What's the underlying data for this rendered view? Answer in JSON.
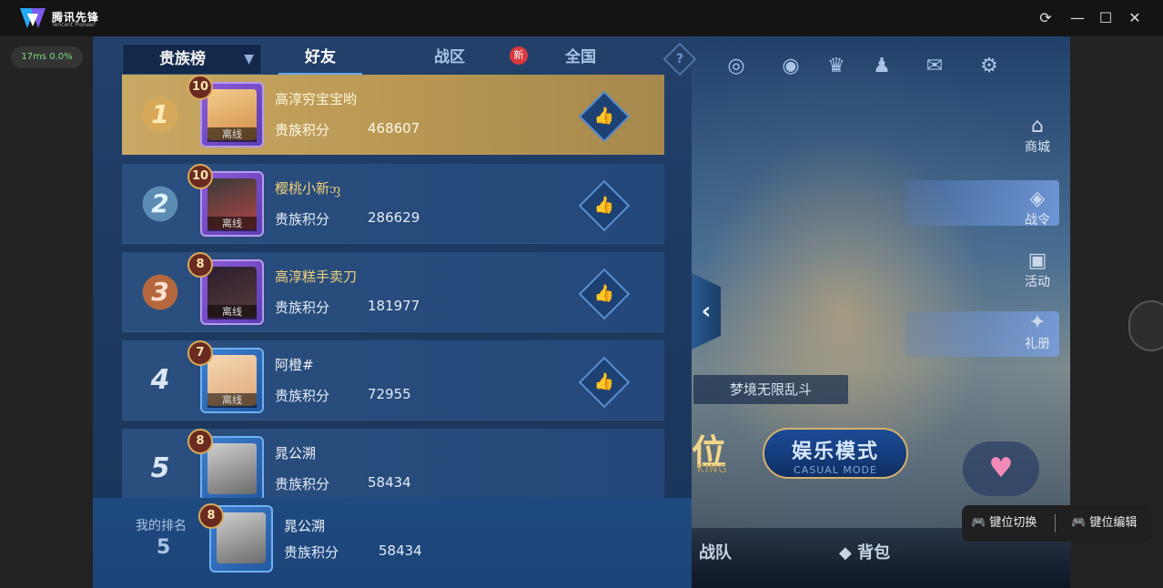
{
  "titlebar": {
    "app_name": "腾讯先锋",
    "app_sub": "Tencent Pioneer",
    "refresh_icon": "⟳",
    "minimize_icon": "—",
    "maximize_icon": "☐",
    "close_icon": "✕"
  },
  "perf": {
    "latency": "17ms",
    "loss": "0.0%"
  },
  "leaderboard": {
    "dropdown_label": "贵族榜",
    "tabs": [
      {
        "label": "好友",
        "active": true
      },
      {
        "label": "战区",
        "active": false
      },
      {
        "label": "全国",
        "active": false
      }
    ],
    "new_badge": "新",
    "help": "?",
    "score_label": "贵族积分",
    "offline_label": "离线",
    "rows": [
      {
        "rank": "1",
        "level": "10",
        "name": "高淳穷宝宝哟",
        "score": "468607",
        "offline": true
      },
      {
        "rank": "2",
        "level": "10",
        "name": "樱桃小新ᦀ",
        "score": "286629",
        "offline": true
      },
      {
        "rank": "3",
        "level": "8",
        "name": "高淳糕手卖刀",
        "score": "181977",
        "offline": true
      },
      {
        "rank": "4",
        "level": "7",
        "name": "阿橙#",
        "score": "72955",
        "offline": true
      },
      {
        "rank": "5",
        "level": "8",
        "name": "晁公溯",
        "score": "58434",
        "offline": false
      }
    ],
    "my_rank": {
      "label": "我的排名",
      "rank": "5",
      "level": "8",
      "name": "晁公溯",
      "score": "58434"
    }
  },
  "game": {
    "side_menu": [
      {
        "label": "商城",
        "icon": "shop-icon"
      },
      {
        "label": "战令",
        "icon": "pass-icon"
      },
      {
        "label": "活动",
        "icon": "event-icon"
      },
      {
        "label": "礼册",
        "icon": "gift-book-icon"
      }
    ],
    "mode_tag": "梦境无限乱斗",
    "rank_button": "位",
    "rank_sub": "KING",
    "casual_main": "娱乐模式",
    "casual_sub": "CASUAL MODE",
    "bottom": [
      {
        "label": "战队"
      },
      {
        "label": "背包"
      }
    ]
  },
  "keymap": {
    "switch_label": "键位切换",
    "edit_label": "键位编辑"
  }
}
